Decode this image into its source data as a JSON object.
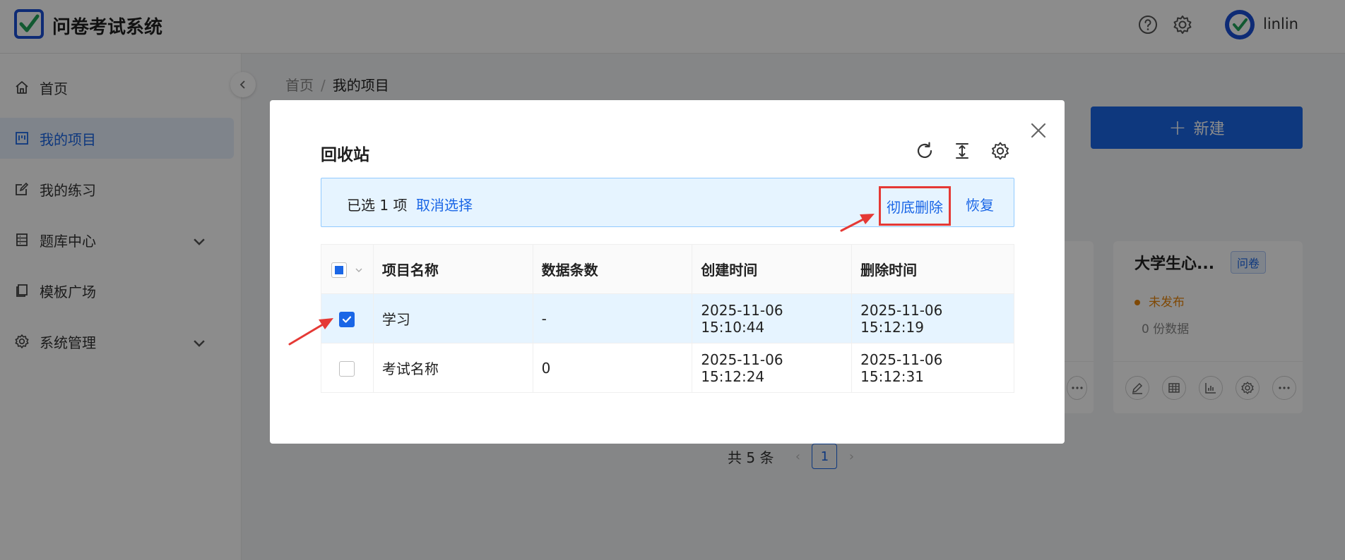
{
  "app": {
    "title": "问卷考试系统"
  },
  "header": {
    "username": "linlin"
  },
  "sidebar": {
    "items": [
      {
        "label": "首页"
      },
      {
        "label": "我的项目"
      },
      {
        "label": "我的练习"
      },
      {
        "label": "题库中心"
      },
      {
        "label": "模板广场"
      },
      {
        "label": "系统管理"
      }
    ]
  },
  "breadcrumb": {
    "home": "首页",
    "separator": "/",
    "current": "我的项目"
  },
  "toolbar": {
    "new_label": "新建",
    "new_plus": "+"
  },
  "card": {
    "title": "大学生心...",
    "tag": "问卷",
    "status": "未发布",
    "count": "0  份数据"
  },
  "pagination": {
    "total": "共 5 条",
    "page": "1"
  },
  "modal": {
    "title": "回收站",
    "selection": {
      "text": "已选 1 项",
      "cancel": "取消选择",
      "delete": "彻底删除",
      "restore": "恢复"
    },
    "columns": [
      "项目名称",
      "数据条数",
      "创建时间",
      "删除时间"
    ],
    "rows": [
      {
        "name": "学习",
        "count": "-",
        "created": "2025-11-06 15:10:44",
        "deleted": "2025-11-06 15:12:19"
      },
      {
        "name": "考试名称",
        "count": "0",
        "created": "2025-11-06 15:12:24",
        "deleted": "2025-11-06 15:12:31"
      }
    ]
  },
  "colors": {
    "primary": "#1a66e6",
    "warning": "#e8860b",
    "annotation": "#e53935",
    "selected_bg": "#e6f4ff"
  }
}
